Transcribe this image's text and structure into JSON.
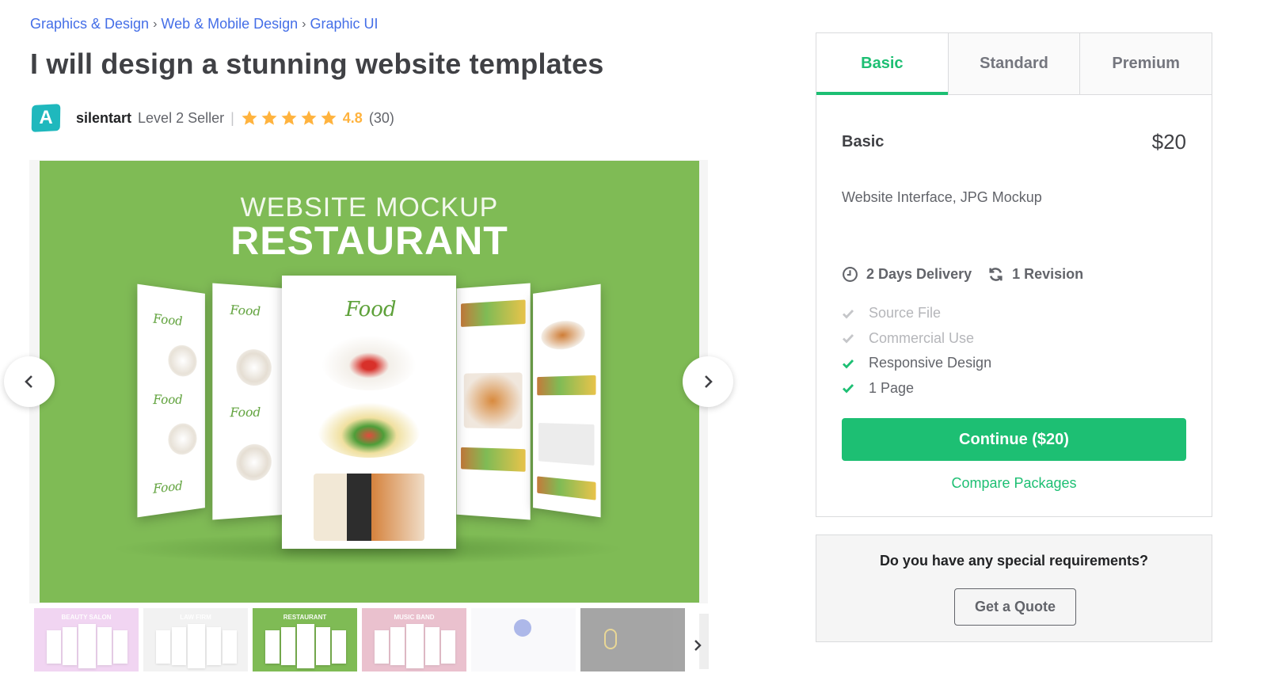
{
  "breadcrumb": [
    {
      "label": "Graphics & Design"
    },
    {
      "label": "Web & Mobile Design"
    },
    {
      "label": "Graphic UI"
    }
  ],
  "breadcrumb_separator": "›",
  "title": "I will design a stunning website templates",
  "seller": {
    "avatar_letter": "A",
    "avatar_color": "#1fb8bd",
    "name": "silentart",
    "level": "Level 2 Seller",
    "divider": "|",
    "stars": 5,
    "rating": "4.8",
    "review_count": "(30)"
  },
  "gallery": {
    "main_image": {
      "subtitle": "WEBSITE MOCKUP",
      "headline": "RESTAURANT",
      "logo_text": "Food",
      "background": "#7fbb55"
    },
    "prev_icon": "chevron-left-icon",
    "next_icon": "chevron-right-icon",
    "thumbnails": [
      {
        "label": "BEAUTY SALON",
        "bg": "#e6b3e8",
        "active": false
      },
      {
        "label": "LAW FIRM",
        "bg": "#e9e9e9",
        "active": false
      },
      {
        "label": "RESTAURANT",
        "bg": "#7fbb55",
        "active": true
      },
      {
        "label": "MUSIC BAND",
        "bg": "#d98fa7",
        "active": false
      },
      {
        "label": "",
        "bg": "#f4f4f8",
        "active": false
      },
      {
        "label": "",
        "bg": "#5c5c5c",
        "active": false
      }
    ]
  },
  "packages": {
    "tabs": [
      {
        "label": "Basic",
        "active": true
      },
      {
        "label": "Standard",
        "active": false
      },
      {
        "label": "Premium",
        "active": false
      }
    ],
    "selected": {
      "name": "Basic",
      "price": "$20",
      "description": "Website Interface, JPG Mockup",
      "delivery": "2 Days Delivery",
      "revisions": "1 Revision",
      "features": [
        {
          "label": "Source File",
          "included": false
        },
        {
          "label": "Commercial Use",
          "included": false
        },
        {
          "label": "Responsive Design",
          "included": true
        },
        {
          "label": "1 Page",
          "included": true
        }
      ],
      "continue_label": "Continue ($20)",
      "compare_label": "Compare Packages"
    },
    "accent_color": "#1dbf73"
  },
  "quote": {
    "question": "Do you have any special requirements?",
    "button_label": "Get a Quote"
  }
}
